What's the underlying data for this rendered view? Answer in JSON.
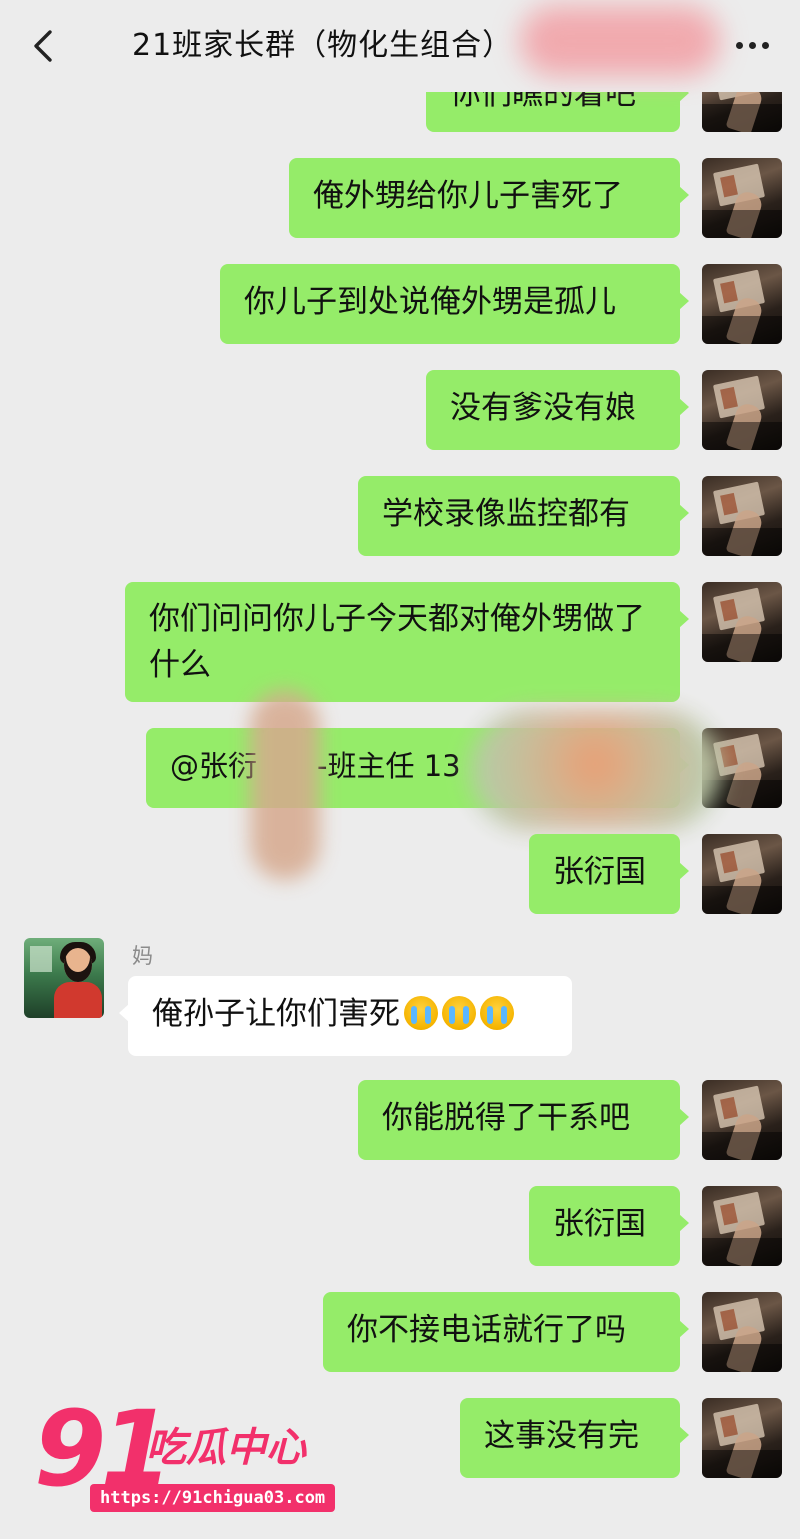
{
  "header": {
    "back_icon": "chevron-left-icon",
    "title": "21班家长群（物化生组合）",
    "more_icon": "more-dots-icon"
  },
  "messages": [
    {
      "side": "right",
      "text": "你们瞧的着吧"
    },
    {
      "side": "right",
      "text": "俺外甥给你儿子害死了"
    },
    {
      "side": "right",
      "text": "你儿子到处说俺外甥是孤儿"
    },
    {
      "side": "right",
      "text": "没有爹没有娘"
    },
    {
      "side": "right",
      "text": "学校录像监控都有"
    },
    {
      "side": "right",
      "text": "你们问问你儿子今天都对俺外甥做了什么"
    },
    {
      "side": "right",
      "text_visible": [
        "@张衍",
        "-班主任 13"
      ]
    },
    {
      "side": "right",
      "text": "张衍国"
    },
    {
      "side": "left",
      "sender": "妈",
      "text": "俺孙子让你们害死",
      "emoji": [
        "crying-emoji",
        "crying-emoji",
        "crying-emoji"
      ]
    },
    {
      "side": "right",
      "text": "你能脱得了干系吧"
    },
    {
      "side": "right",
      "text": "张衍国"
    },
    {
      "side": "right",
      "text": "你不接电话就行了吗"
    },
    {
      "side": "right",
      "text": "这事没有完"
    }
  ],
  "watermark": {
    "number": "91",
    "name": "吃瓜中心",
    "url": "https://91chigua03.com"
  },
  "colors": {
    "background": "#ececec",
    "own_bubble": "#95ec69",
    "other_bubble": "#ffffff",
    "watermark": "#f2306b"
  }
}
